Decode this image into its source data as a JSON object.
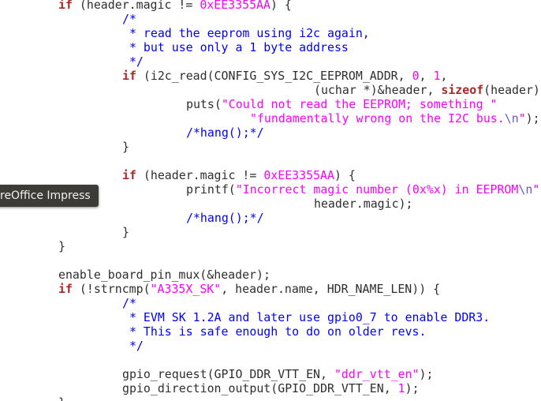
{
  "tooltip": {
    "label": "reOffice Impress"
  },
  "code_lines": [
    {
      "indent": 0,
      "tokens": [
        [
          "kw",
          "if"
        ],
        [
          "plain",
          " (header.magic != "
        ],
        [
          "num",
          "0xEE3355AA"
        ],
        [
          "plain",
          ") {"
        ]
      ]
    },
    {
      "indent": 9,
      "tokens": [
        [
          "cm",
          "/*"
        ]
      ]
    },
    {
      "indent": 9,
      "tokens": [
        [
          "cm",
          " * read the eeprom using i2c again,"
        ]
      ]
    },
    {
      "indent": 9,
      "tokens": [
        [
          "cm",
          " * but use only a 1 byte address"
        ]
      ]
    },
    {
      "indent": 9,
      "tokens": [
        [
          "cm",
          " */"
        ]
      ]
    },
    {
      "indent": 9,
      "tokens": [
        [
          "kw",
          "if"
        ],
        [
          "plain",
          " (i2c_read(CONFIG_SYS_I2C_EEPROM_ADDR, "
        ],
        [
          "num",
          "0"
        ],
        [
          "plain",
          ", "
        ],
        [
          "num",
          "1"
        ],
        [
          "plain",
          ","
        ]
      ]
    },
    {
      "indent": 36,
      "tokens": [
        [
          "plain",
          "(uchar *)&header, "
        ],
        [
          "kw",
          "sizeof"
        ],
        [
          "plain",
          "(header))) {"
        ]
      ]
    },
    {
      "indent": 18,
      "tokens": [
        [
          "plain",
          "puts("
        ],
        [
          "str",
          "\"Could not read the EEPROM; something \""
        ]
      ]
    },
    {
      "indent": 27,
      "tokens": [
        [
          "str",
          "\"fundamentally wrong on the I2C bus."
        ],
        [
          "esc",
          "\\n"
        ],
        [
          "str",
          "\""
        ],
        [
          "plain",
          ");"
        ]
      ]
    },
    {
      "indent": 18,
      "tokens": [
        [
          "cm",
          "/*hang();*/"
        ]
      ]
    },
    {
      "indent": 9,
      "tokens": [
        [
          "plain",
          "}"
        ]
      ]
    },
    {
      "indent": 0,
      "tokens": []
    },
    {
      "indent": 9,
      "tokens": [
        [
          "kw",
          "if"
        ],
        [
          "plain",
          " (header.magic != "
        ],
        [
          "num",
          "0xEE3355AA"
        ],
        [
          "plain",
          ") {"
        ]
      ]
    },
    {
      "indent": 18,
      "tokens": [
        [
          "plain",
          "printf("
        ],
        [
          "str",
          "\"Incorrect magic number (0x%x) in EEPROM"
        ],
        [
          "esc",
          "\\n"
        ],
        [
          "str",
          "\""
        ],
        [
          "plain",
          ","
        ]
      ]
    },
    {
      "indent": 36,
      "tokens": [
        [
          "plain",
          "header.magic);"
        ]
      ]
    },
    {
      "indent": 18,
      "tokens": [
        [
          "cm",
          "/*hang();*/"
        ]
      ]
    },
    {
      "indent": 9,
      "tokens": [
        [
          "plain",
          "}"
        ]
      ]
    },
    {
      "indent": 0,
      "tokens": [
        [
          "plain",
          "}"
        ]
      ]
    },
    {
      "indent": 0,
      "tokens": []
    },
    {
      "indent": 0,
      "tokens": [
        [
          "plain",
          "enable_board_pin_mux(&header);"
        ]
      ]
    },
    {
      "indent": 0,
      "tokens": [
        [
          "kw",
          "if"
        ],
        [
          "plain",
          " (!strncmp("
        ],
        [
          "str",
          "\"A335X_SK\""
        ],
        [
          "plain",
          ", header.name, HDR_NAME_LEN)) {"
        ]
      ]
    },
    {
      "indent": 9,
      "tokens": [
        [
          "cm",
          "/*"
        ]
      ]
    },
    {
      "indent": 9,
      "tokens": [
        [
          "cm",
          " * EVM SK 1.2A and later use gpio0_7 to enable DDR3."
        ]
      ]
    },
    {
      "indent": 9,
      "tokens": [
        [
          "cm",
          " * This is safe enough to do on older revs."
        ]
      ]
    },
    {
      "indent": 9,
      "tokens": [
        [
          "cm",
          " */"
        ]
      ]
    },
    {
      "indent": 0,
      "tokens": []
    },
    {
      "indent": 9,
      "tokens": [
        [
          "plain",
          "gpio_request(GPIO_DDR_VTT_EN, "
        ],
        [
          "str",
          "\"ddr_vtt_en\""
        ],
        [
          "plain",
          ");"
        ]
      ]
    },
    {
      "indent": 9,
      "tokens": [
        [
          "plain",
          "gpio_direction_output(GPIO_DDR_VTT_EN, "
        ],
        [
          "num",
          "1"
        ],
        [
          "plain",
          ");"
        ]
      ]
    },
    {
      "indent": 0,
      "tokens": [
        [
          "plain",
          "}"
        ]
      ]
    }
  ]
}
